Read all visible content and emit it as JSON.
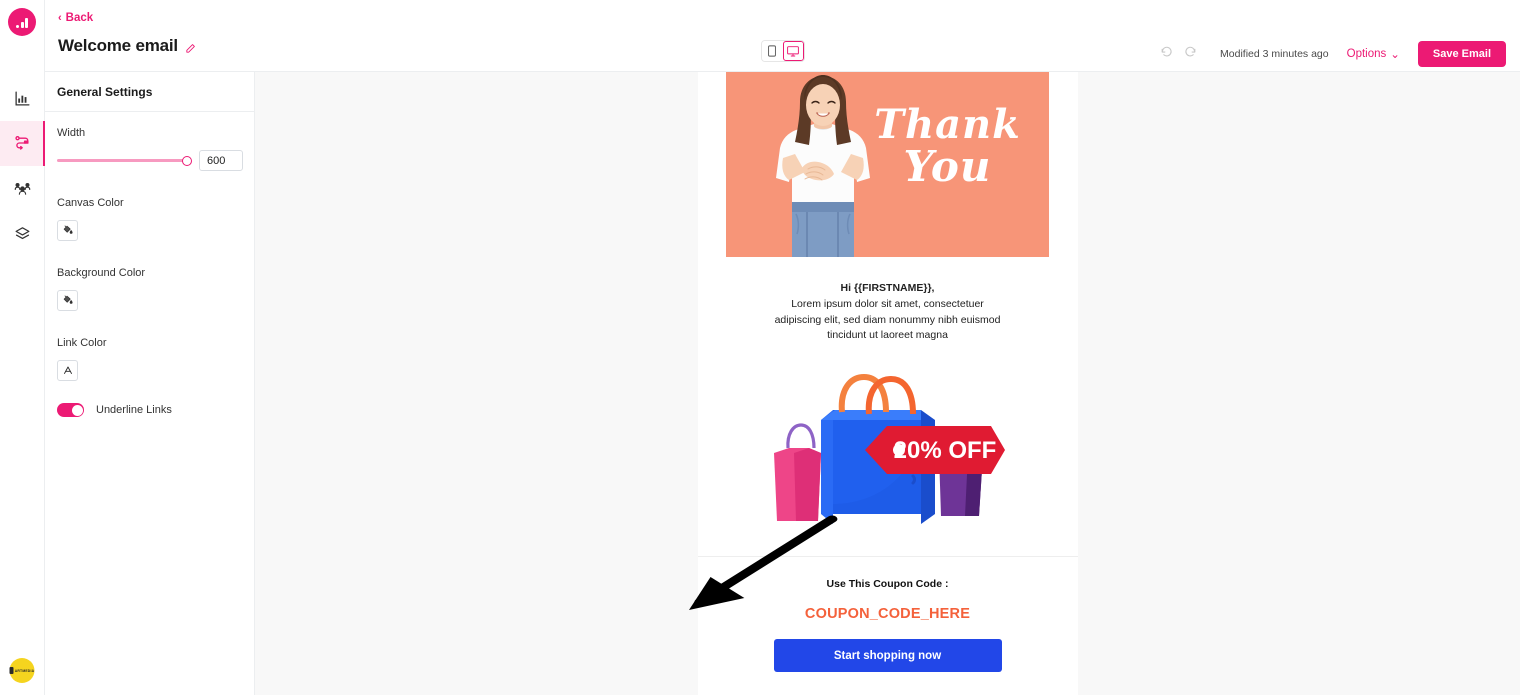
{
  "app": {
    "brand_icon": "bar-chart-logo",
    "badge_text": "ARTMEDIA"
  },
  "rail": {
    "items": [
      {
        "name": "analytics",
        "icon": "bar-chart-icon",
        "active": false
      },
      {
        "name": "automation",
        "icon": "workflow-icon",
        "active": true
      },
      {
        "name": "audience",
        "icon": "users-group-icon",
        "active": false
      },
      {
        "name": "products",
        "icon": "box-layers-icon",
        "active": false
      }
    ]
  },
  "topbar": {
    "back_label": "Back",
    "back_chevron": "‹",
    "title": "Welcome email",
    "edit_icon": "pencil-icon",
    "device_mobile": "mobile-icon",
    "device_desktop": "desktop-icon",
    "selected_device": "desktop",
    "undo_icon": "undo-arrow-icon",
    "redo_icon": "redo-arrow-icon",
    "modified_text": "Modified 3 minutes ago",
    "options_label": "Options",
    "options_chevron": "⌄",
    "save_label": "Save Email",
    "accent_color": "#EC1A74"
  },
  "settings": {
    "heading": "General Settings",
    "width": {
      "label": "Width",
      "value": "600",
      "slider_percent": 100
    },
    "canvas_color": {
      "label": "Canvas Color",
      "icon": "paint-bucket-icon",
      "swatch": "#e9e9e9"
    },
    "background_color": {
      "label": "Background Color",
      "icon": "paint-bucket-icon",
      "swatch": "#e9e9e9"
    },
    "link_color": {
      "label": "Link Color",
      "icon": "text-color-icon",
      "swatch": "#2247E8"
    },
    "underline_links": {
      "label": "Underline Links",
      "enabled": true
    }
  },
  "email": {
    "hero": {
      "background_color": "#F79578",
      "script_line1": "Thank",
      "script_line2": "You",
      "photo_alt": "smiling-woman-photo"
    },
    "greeting_line1": "Hi {{FIRSTNAME}},",
    "greeting_line2": "Lorem ipsum dolor sit amet, consectetuer",
    "greeting_line3": "adipiscing elit, sed diam nonummy nibh euismod",
    "greeting_line4": "tincidunt ut laoreet magna",
    "promo": {
      "illustration": "shopping-bags-illustration",
      "badge_text": "20% OFF",
      "badge_color": "#E01B32"
    },
    "coupon_label": "Use This Coupon Code :",
    "coupon_code": "COUPON_CODE_HERE",
    "coupon_code_color": "#F4613B",
    "cta_label": "Start shopping now",
    "cta_color": "#2247E8"
  }
}
